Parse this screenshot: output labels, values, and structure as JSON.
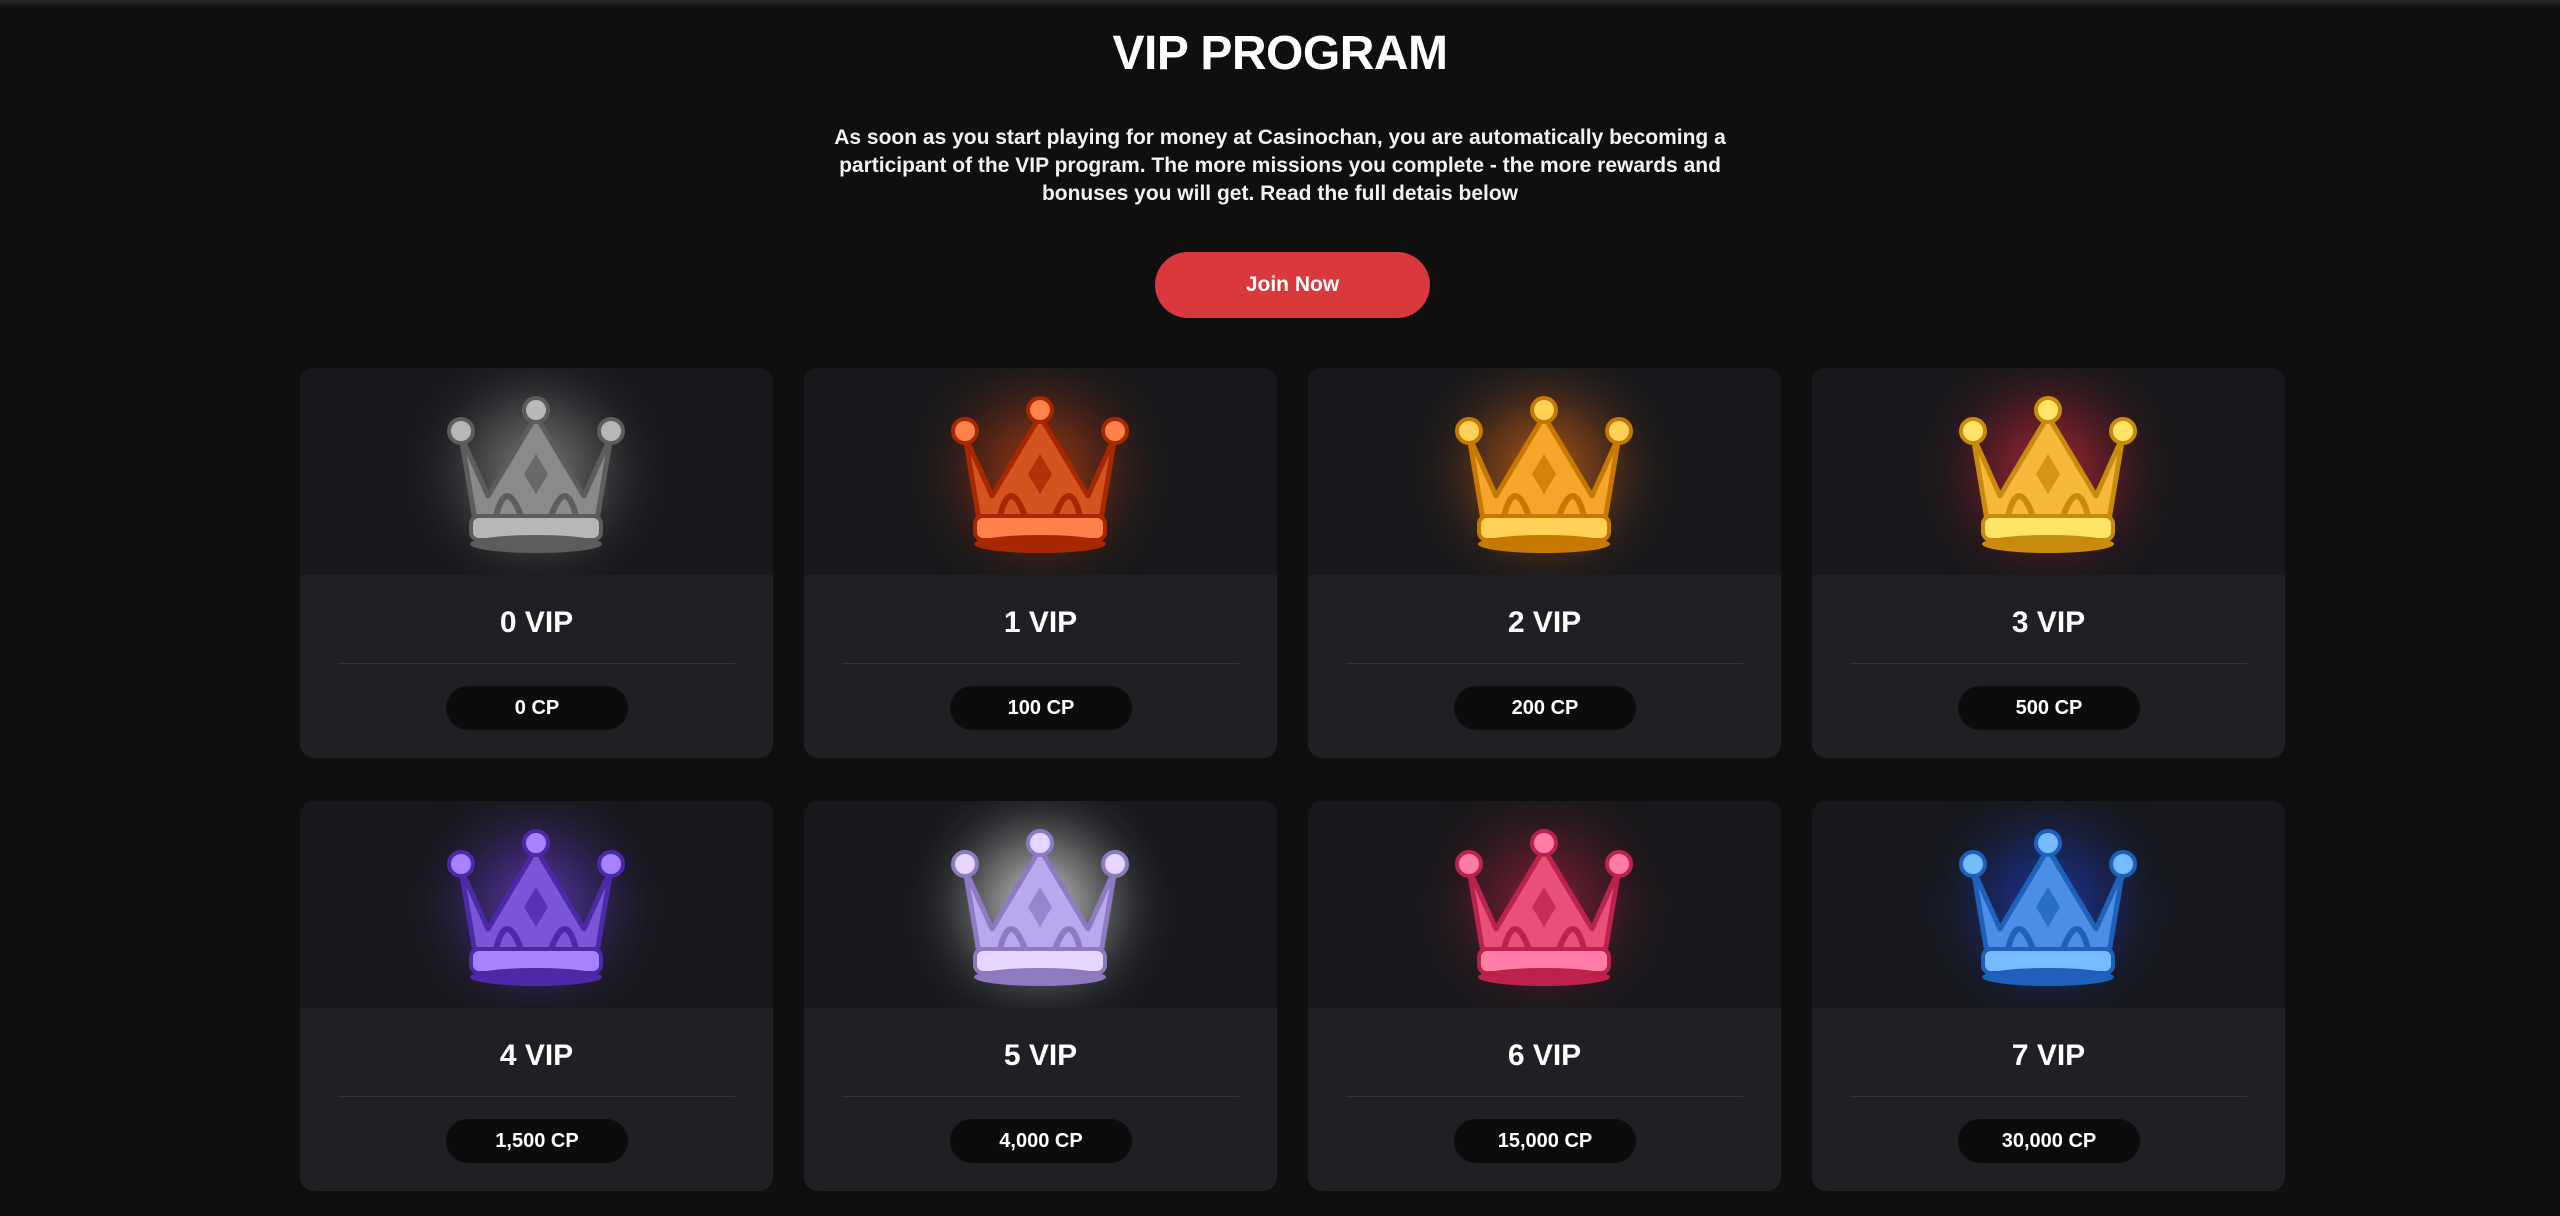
{
  "header": {
    "title": "VIP PROGRAM",
    "intro": "As soon as you start playing for money at Casinochan, you are automatically becoming a participant of the VIP program. The more missions you complete - the more rewards and bonuses you will get. Read the full detais below",
    "join_label": "Join Now",
    "join_color": "#d9393d"
  },
  "levels": [
    {
      "title": "0 VIP",
      "points": "0 CP",
      "icon": "gray-crown-icon",
      "color": "#8a8a8a",
      "glow": "#9a9a9a"
    },
    {
      "title": "1 VIP",
      "points": "100 CP",
      "icon": "bronze-crown-icon",
      "color": "#d4541f",
      "glow": "#c9420f"
    },
    {
      "title": "2 VIP",
      "points": "200 CP",
      "icon": "gold-crown-icon",
      "color": "#f4a52a",
      "glow": "#e06a18"
    },
    {
      "title": "3 VIP",
      "points": "500 CP",
      "icon": "ruby-gold-crown-icon",
      "color": "#f6b83a",
      "glow": "#d6283a"
    },
    {
      "title": "4 VIP",
      "points": "1,500 CP",
      "icon": "violet-crown-icon",
      "color": "#7a55d6",
      "glow": "#6a3fd8"
    },
    {
      "title": "5 VIP",
      "points": "4,000 CP",
      "icon": "silver-crown-icon",
      "color": "#b9a8ee",
      "glow": "#ffffff"
    },
    {
      "title": "6 VIP",
      "points": "15,000 CP",
      "icon": "rose-crown-icon",
      "color": "#e8507a",
      "glow": "#a5233f"
    },
    {
      "title": "7 VIP",
      "points": "30,000 CP",
      "icon": "ice-crown-icon",
      "color": "#4a8ee8",
      "glow": "#1f3fc8"
    }
  ]
}
